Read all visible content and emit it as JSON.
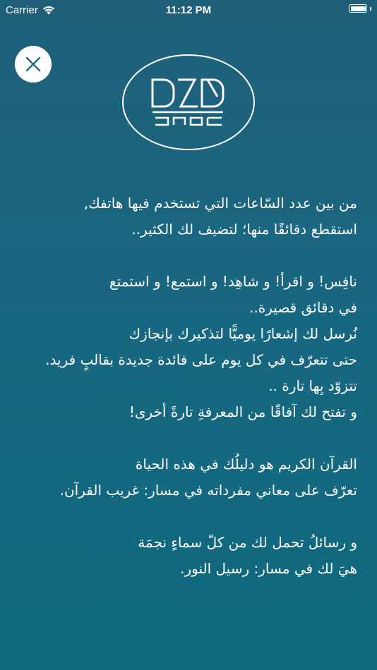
{
  "status_bar": {
    "carrier": "Carrier",
    "time": "11:12 PM",
    "battery_level": 1.0
  },
  "colors": {
    "background_top": "#1f5f78",
    "background_bottom": "#0f6a7e",
    "text": "#ffffff",
    "close_icon": "#1c6a80"
  },
  "icons": {
    "close": "close-icon",
    "wifi": "wifi-icon",
    "battery": "battery-icon"
  },
  "paragraphs": [
    [
      "من بين عدد السّاعات التي تستخدم فيها هاتفك,",
      "استقطع دقائقًا منها؛ لتضيف لك الكثير.."
    ],
    [
      "نافِس! و اقرأ! و شاهِد! و استمع! و استمتع",
      "في دقائق قصيرة..",
      "نُرسل لك إشعارًا يوميًّا لتذكيرك بإنجازك",
      "حتى تتعرّف في كل يوم على فائدة جديدة بقالبٍ فريد.",
      "تتزوّد بِها تارة ..",
      "و تفتح لك آفاقًا من المعرفةِ تارةً أخرى!"
    ],
    [
      "القرآن الكريم هو دليلُك في هذه الحياة",
      "تعرّف على معاني مفرداته في مسار: غريب القرآن."
    ],
    [
      "و رسائلُ تحمل لك من كلّ سماءٍ نجمَة",
      "هيَ لك في مسار: رسيل النور."
    ]
  ]
}
